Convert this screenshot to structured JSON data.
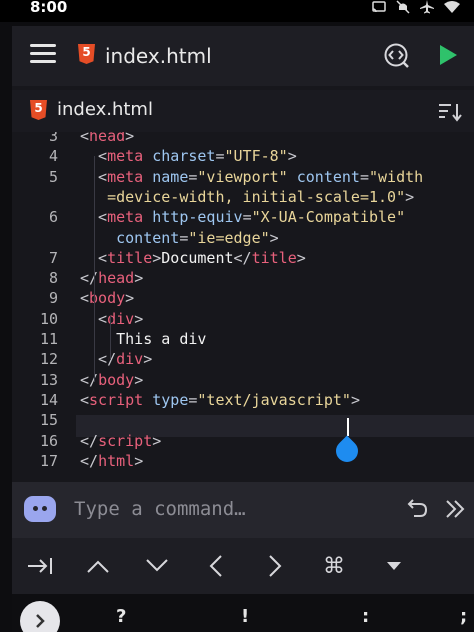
{
  "status_bar": {
    "time": "8:00",
    "icons": [
      "cast-icon",
      "mute-icon",
      "airplane-icon",
      "wifi-icon"
    ]
  },
  "toolbar": {
    "file_title": "index.html",
    "icons": [
      "menu-icon",
      "html5-icon",
      "code-preview-icon",
      "run-icon"
    ],
    "accent_color": "#2fc26b"
  },
  "tab": {
    "label": "index.html"
  },
  "editor": {
    "lines": [
      {
        "num": "3",
        "tokens": [
          [
            "pun",
            "<"
          ],
          [
            "tag",
            "head"
          ],
          [
            "pun",
            ">"
          ]
        ]
      },
      {
        "num": "4",
        "tokens": [
          [
            "pun",
            "  <"
          ],
          [
            "tag",
            "meta"
          ],
          [
            "txt",
            " "
          ],
          [
            "attr",
            "charset"
          ],
          [
            "pun",
            "="
          ],
          [
            "str",
            "\"UTF-8\""
          ],
          [
            "pun",
            ">"
          ]
        ]
      },
      {
        "num": "5",
        "tokens": [
          [
            "pun",
            "  <"
          ],
          [
            "tag",
            "meta"
          ],
          [
            "txt",
            " "
          ],
          [
            "attr",
            "name"
          ],
          [
            "pun",
            "="
          ],
          [
            "str",
            "\"viewport\""
          ],
          [
            "txt",
            " "
          ],
          [
            "attr",
            "content"
          ],
          [
            "pun",
            "="
          ],
          [
            "str",
            "\"width"
          ]
        ]
      },
      {
        "num": "",
        "tokens": [
          [
            "str",
            "   =device-width, initial-scale=1.0\""
          ],
          [
            "pun",
            ">"
          ]
        ]
      },
      {
        "num": "6",
        "tokens": [
          [
            "pun",
            "  <"
          ],
          [
            "tag",
            "meta"
          ],
          [
            "txt",
            " "
          ],
          [
            "attr",
            "http-equiv"
          ],
          [
            "pun",
            "="
          ],
          [
            "str",
            "\"X-UA-Compatible\""
          ]
        ]
      },
      {
        "num": "",
        "tokens": [
          [
            "txt",
            "    "
          ],
          [
            "attr",
            "content"
          ],
          [
            "pun",
            "="
          ],
          [
            "str",
            "\"ie=edge\""
          ],
          [
            "pun",
            ">"
          ]
        ]
      },
      {
        "num": "7",
        "tokens": [
          [
            "pun",
            "  <"
          ],
          [
            "tag",
            "title"
          ],
          [
            "pun",
            ">"
          ],
          [
            "txt",
            "Document"
          ],
          [
            "pun",
            "</"
          ],
          [
            "tag",
            "title"
          ],
          [
            "pun",
            ">"
          ]
        ]
      },
      {
        "num": "8",
        "tokens": [
          [
            "pun",
            "</"
          ],
          [
            "tag",
            "head"
          ],
          [
            "pun",
            ">"
          ]
        ]
      },
      {
        "num": "9",
        "tokens": [
          [
            "pun",
            "<"
          ],
          [
            "tag",
            "body"
          ],
          [
            "pun",
            ">"
          ]
        ]
      },
      {
        "num": "10",
        "tokens": [
          [
            "pun",
            "  <"
          ],
          [
            "tag",
            "div"
          ],
          [
            "pun",
            ">"
          ]
        ]
      },
      {
        "num": "11",
        "tokens": [
          [
            "txt",
            "    This a div"
          ]
        ]
      },
      {
        "num": "12",
        "tokens": [
          [
            "pun",
            "  </"
          ],
          [
            "tag",
            "div"
          ],
          [
            "pun",
            ">"
          ]
        ]
      },
      {
        "num": "13",
        "tokens": [
          [
            "pun",
            "</"
          ],
          [
            "tag",
            "body"
          ],
          [
            "pun",
            ">"
          ]
        ]
      },
      {
        "num": "14",
        "tokens": [
          [
            "pun",
            "<"
          ],
          [
            "tag",
            "script"
          ],
          [
            "txt",
            " "
          ],
          [
            "attr",
            "type"
          ],
          [
            "pun",
            "="
          ],
          [
            "str",
            "\"text/javascript\""
          ],
          [
            "pun",
            ">"
          ]
        ]
      },
      {
        "num": "15",
        "tokens": []
      },
      {
        "num": "16",
        "tokens": [
          [
            "pun",
            "</"
          ],
          [
            "tag",
            "script"
          ],
          [
            "pun",
            ">"
          ]
        ]
      },
      {
        "num": "17",
        "tokens": [
          [
            "pun",
            "</"
          ],
          [
            "tag",
            "html"
          ],
          [
            "pun",
            ">"
          ]
        ]
      }
    ],
    "current_line": "14"
  },
  "command_bar": {
    "placeholder": "Type a command…",
    "icons": [
      "assistant-bot-icon",
      "undo-icon",
      "forward-double-chevron-icon"
    ]
  },
  "symbol_keys": {
    "icons": [
      "tab-icon",
      "arrow-up-icon",
      "arrow-down-icon",
      "arrow-left-icon",
      "arrow-right-icon",
      "command-icon",
      "caret-down-icon"
    ],
    "command_glyph": "⌘"
  },
  "keyboard": {
    "keys": [
      "?",
      "!",
      ":",
      ";"
    ]
  }
}
